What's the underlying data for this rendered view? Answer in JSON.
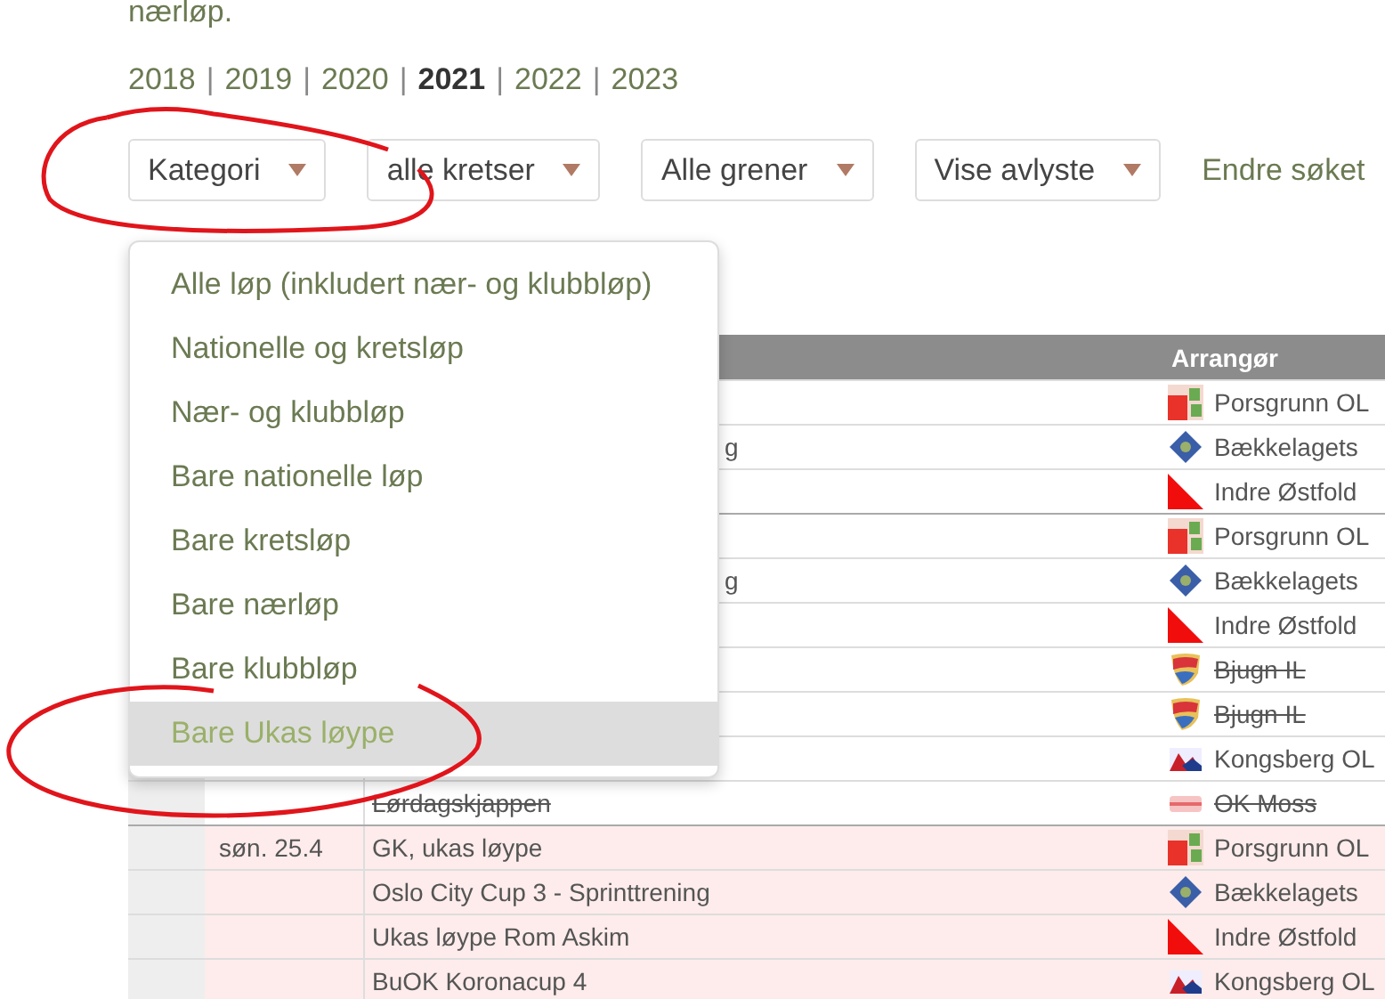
{
  "intro_text": "nærløp.",
  "years": [
    {
      "label": "2018",
      "selected": false
    },
    {
      "separator": "|",
      "label": "2019",
      "selected": false
    },
    {
      "separator": "|",
      "label": "2020",
      "selected": false
    },
    {
      "separator": "|",
      "label": "2021",
      "selected": true
    },
    {
      "separator": "|",
      "label": "2022",
      "selected": false
    },
    {
      "separator": "|",
      "label": "2023",
      "selected": false
    }
  ],
  "filters": [
    {
      "label": "Kategori"
    },
    {
      "label": "alle kretser"
    },
    {
      "label": "Alle grener"
    },
    {
      "label": "Vise avlyste"
    }
  ],
  "change_search_link": "Endre søket",
  "category_menu": {
    "items": [
      {
        "label": "Alle løp (inkludert nær- og klubbløp)",
        "selected": false
      },
      {
        "label": "Nationelle og kretsløp",
        "selected": false
      },
      {
        "label": "Nær- og klubbløp",
        "selected": false
      },
      {
        "label": "Bare nationelle løp",
        "selected": false
      },
      {
        "label": "Bare kretsløp",
        "selected": false
      },
      {
        "label": "Bare nærløp",
        "selected": false
      },
      {
        "label": "Bare klubbløp",
        "selected": false
      },
      {
        "label": "Bare Ukas løype",
        "selected": true
      }
    ]
  },
  "table": {
    "columns": [
      "Arrangør"
    ],
    "rows": [
      {
        "kind": "covered",
        "organizer": {
          "kind": "tile",
          "name": "Porsgrunn OL"
        },
        "cancelled": false,
        "highlighted": false,
        "group_start": false
      },
      {
        "kind": "tail",
        "event": "g",
        "organizer": {
          "kind": "diamond",
          "name": "Bækkelagets"
        },
        "cancelled": false,
        "highlighted": false,
        "group_start": false
      },
      {
        "kind": "covered",
        "organizer": {
          "kind": "triangle",
          "name": "Indre Østfold"
        },
        "cancelled": false,
        "highlighted": false,
        "group_start": false
      },
      {
        "kind": "covered",
        "organizer": {
          "kind": "tile",
          "name": "Porsgrunn OL"
        },
        "cancelled": false,
        "highlighted": false,
        "group_start": true
      },
      {
        "kind": "tail",
        "event": "g",
        "organizer": {
          "kind": "diamond",
          "name": "Bækkelagets"
        },
        "cancelled": false,
        "highlighted": false,
        "group_start": false
      },
      {
        "kind": "covered",
        "organizer": {
          "kind": "triangle",
          "name": "Indre Østfold"
        },
        "cancelled": false,
        "highlighted": false,
        "group_start": false
      },
      {
        "kind": "covered",
        "organizer": {
          "kind": "shield",
          "name": "Bjugn IL"
        },
        "cancelled": true,
        "highlighted": false,
        "group_start": false
      },
      {
        "kind": "covered",
        "organizer": {
          "kind": "shield",
          "name": "Bjugn IL"
        },
        "cancelled": true,
        "highlighted": false,
        "group_start": false
      },
      {
        "kind": "covered",
        "organizer": {
          "kind": "mountain",
          "name": "Kongsberg OL"
        },
        "cancelled": false,
        "highlighted": false,
        "group_start": false
      },
      {
        "kind": "full",
        "event": "Lørdagskjappen",
        "organizer": {
          "kind": "stripes",
          "name": "OK Moss"
        },
        "cancelled": true,
        "highlighted": false,
        "group_start": false
      },
      {
        "kind": "full",
        "date": "søn. 25.4",
        "event": "GK, ukas løype",
        "organizer": {
          "kind": "tile",
          "name": "Porsgrunn OL"
        },
        "cancelled": false,
        "highlighted": true,
        "group_start": true
      },
      {
        "kind": "full",
        "event": "Oslo City Cup 3 - Sprinttrening",
        "organizer": {
          "kind": "diamond",
          "name": "Bækkelagets"
        },
        "cancelled": false,
        "highlighted": true,
        "group_start": false
      },
      {
        "kind": "full",
        "event": "Ukas løype Rom Askim",
        "organizer": {
          "kind": "triangle",
          "name": "Indre Østfold"
        },
        "cancelled": false,
        "highlighted": true,
        "group_start": false
      },
      {
        "kind": "full",
        "event": "BuOK Koronacup 4",
        "organizer": {
          "kind": "mountain",
          "name": "Kongsberg OL"
        },
        "cancelled": false,
        "highlighted": true,
        "group_start": false
      }
    ]
  }
}
